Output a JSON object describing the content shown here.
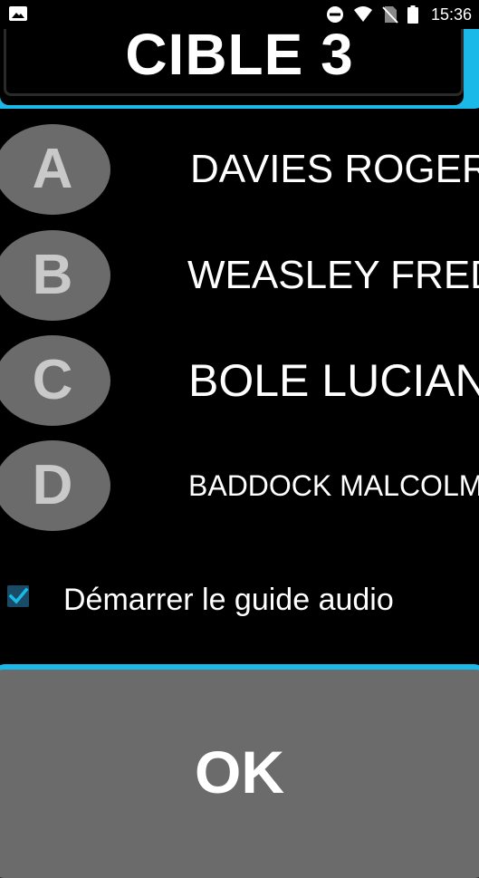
{
  "status_bar": {
    "time": "15:36",
    "icons": [
      "image-icon",
      "do-not-disturb-icon",
      "wifi-icon",
      "no-sim-icon",
      "battery-icon"
    ]
  },
  "header": {
    "title": "CIBLE 3"
  },
  "options": [
    {
      "letter": "A",
      "name": "DAVIES ROGER"
    },
    {
      "letter": "B",
      "name": "WEASLEY FRED"
    },
    {
      "letter": "C",
      "name": "BOLE LUCIAN"
    },
    {
      "letter": "D",
      "name": "BADDOCK MALCOLM"
    }
  ],
  "audio_guide": {
    "label": "Démarrer le guide audio",
    "checked": true
  },
  "ok_button": {
    "label": "OK"
  },
  "colors": {
    "accent": "#1bb9e8",
    "bubble": "#6b6b6b",
    "background": "#000000"
  }
}
